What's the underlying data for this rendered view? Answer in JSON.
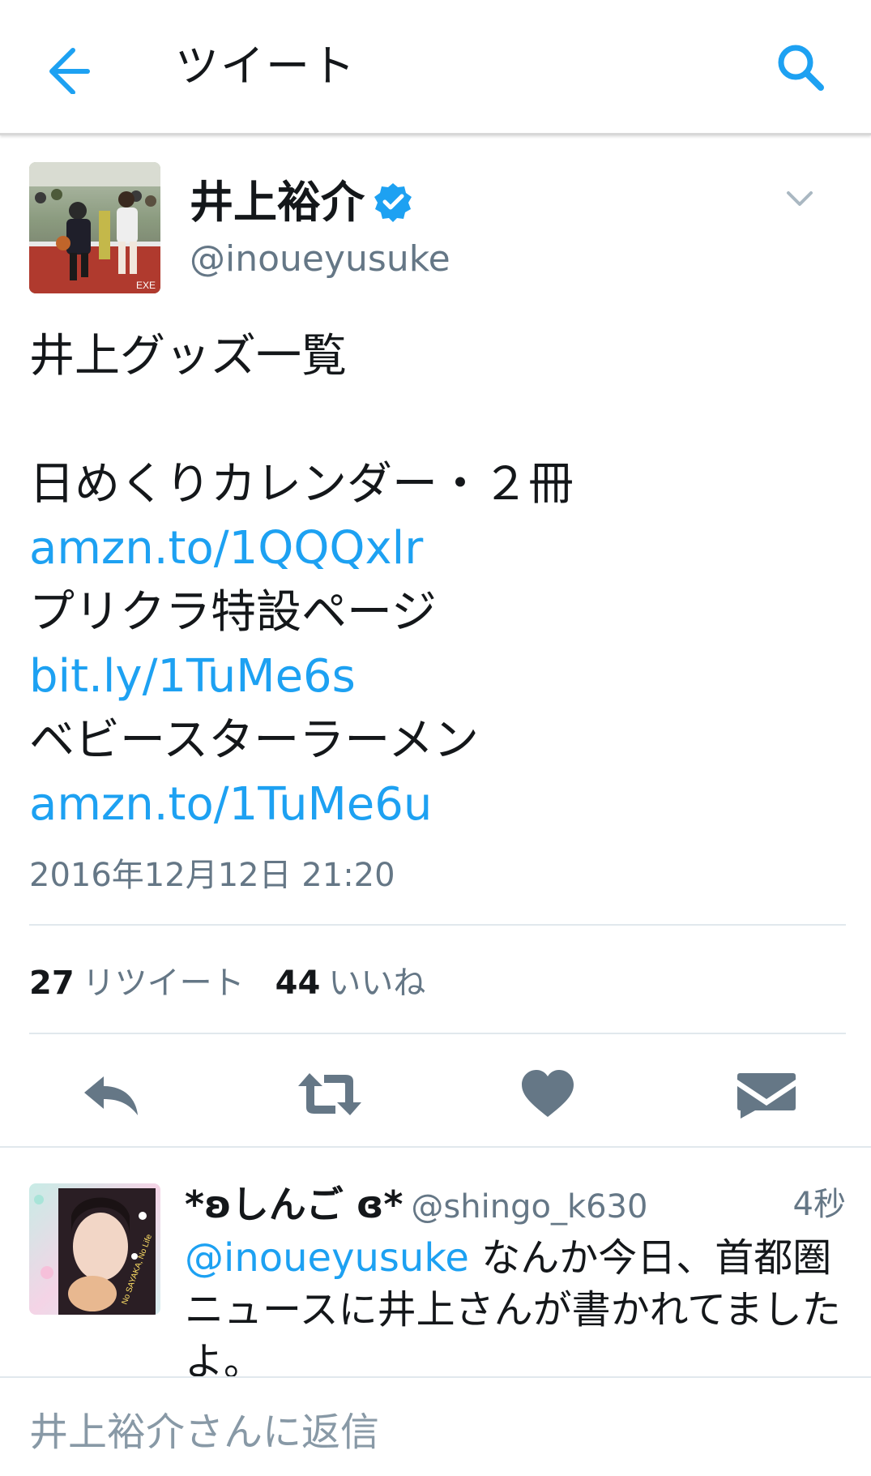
{
  "header": {
    "title": "ツイート",
    "back_icon": "arrow-left-icon",
    "search_icon": "search-icon",
    "accent_color": "#1da1f2"
  },
  "tweet": {
    "author_name": "井上裕介",
    "author_handle": "@inoueyusuke",
    "verified": true,
    "lines": [
      {
        "text": "井上グッズ一覧",
        "type": "text"
      },
      {
        "text": "",
        "type": "blank"
      },
      {
        "text": "日めくりカレンダー・２冊",
        "type": "text"
      },
      {
        "text": "amzn.to/1QQQxlr",
        "type": "link"
      },
      {
        "text": "プリクラ特設ページ",
        "type": "text"
      },
      {
        "text": "bit.ly/1TuMe6s",
        "type": "link"
      },
      {
        "text": "ベビースターラーメン",
        "type": "text"
      },
      {
        "text": "amzn.to/1TuMe6u",
        "type": "link"
      }
    ],
    "timestamp": "2016年12月12日 21:20",
    "retweet_count": "27",
    "retweet_label": "リツイート",
    "like_count": "44",
    "like_label": "いいね"
  },
  "actions": [
    {
      "name": "reply-icon"
    },
    {
      "name": "retweet-icon"
    },
    {
      "name": "like-heart-icon"
    },
    {
      "name": "direct-message-icon"
    }
  ],
  "reply": {
    "name": "*ʚしんご ɞ*",
    "handle": "@shingo_k630",
    "time": "4秒",
    "mention": "@inoueyusuke",
    "text_line1": " なんか今日、首都圏",
    "text_line2": "ニュースに井上さんが書かれてました",
    "text_line3": "よ。"
  },
  "reply_box": {
    "placeholder": "井上裕介さんに返信"
  }
}
